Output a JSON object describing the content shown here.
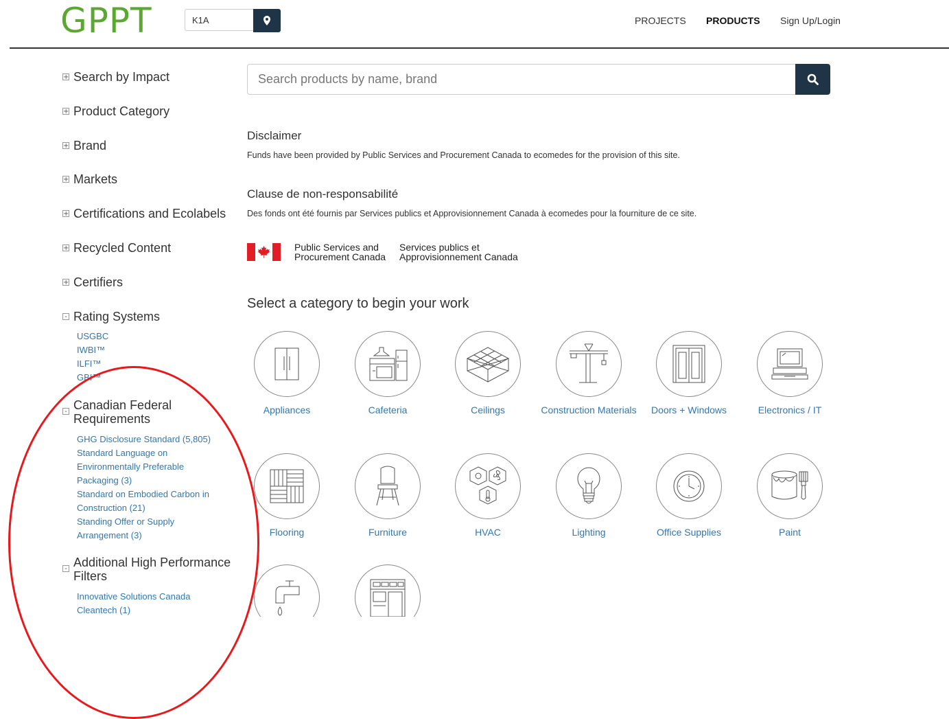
{
  "header": {
    "logo": "GPPT",
    "location_value": "K1A",
    "nav": [
      "PROJECTS",
      "PRODUCTS",
      "Sign Up/Login"
    ]
  },
  "sidebar": {
    "items": [
      {
        "toggle": "+",
        "label": "Search by Impact"
      },
      {
        "toggle": "+",
        "label": "Product Category"
      },
      {
        "toggle": "+",
        "label": "Brand"
      },
      {
        "toggle": "+",
        "label": "Markets"
      },
      {
        "toggle": "+",
        "label": "Certifications and Ecolabels"
      },
      {
        "toggle": "+",
        "label": "Recycled Content"
      },
      {
        "toggle": "+",
        "label": "Certifiers"
      },
      {
        "toggle": "-",
        "label": "Rating Systems"
      },
      {
        "toggle": "-",
        "label": "Canadian Federal Requirements"
      },
      {
        "toggle": "-",
        "label": "Additional High Performance Filters"
      }
    ],
    "rating_systems": [
      "USGBC",
      "IWBI™",
      "ILFI™",
      "GBI™"
    ],
    "federal_requirements": [
      "GHG Disclosure Standard (5,805)",
      "Standard Language on Environmentally Preferable Packaging (3)",
      "Standard on Embodied Carbon in Construction (21)",
      "Standing Offer or Supply Arrangement (3)"
    ],
    "additional_filters": [
      "Innovative Solutions Canada Cleantech (1)"
    ]
  },
  "search": {
    "placeholder": "Search products by name, brand"
  },
  "disclaimer": {
    "title_en": "Disclaimer",
    "text_en": "Funds have been provided by Public Services and Procurement Canada to ecomedes for the provision of this site.",
    "title_fr": "Clause de non-responsabilité",
    "text_fr": "Des fonds ont été fournis par Services publics et Approvisionnement Canada à ecomedes pour la fourniture de ce site.",
    "org_en_1": "Public Services and",
    "org_en_2": "Procurement Canada",
    "org_fr_1": "Services publics et",
    "org_fr_2": "Approvisionnement Canada"
  },
  "categories_title": "Select a category to begin your work",
  "categories": [
    {
      "label": "Appliances",
      "icon": "refrigerator-icon"
    },
    {
      "label": "Cafeteria",
      "icon": "kitchen-icon"
    },
    {
      "label": "Ceilings",
      "icon": "ceiling-grid-icon"
    },
    {
      "label": "Construction Materials",
      "icon": "crane-icon"
    },
    {
      "label": "Doors + Windows",
      "icon": "double-door-icon"
    },
    {
      "label": "Electronics / IT",
      "icon": "computer-icon"
    },
    {
      "label": "Flooring",
      "icon": "parquet-icon"
    },
    {
      "label": "Furniture",
      "icon": "chair-icon"
    },
    {
      "label": "HVAC",
      "icon": "hvac-icon"
    },
    {
      "label": "Lighting",
      "icon": "light-bulb-icon"
    },
    {
      "label": "Office Supplies",
      "icon": "clock-icon"
    },
    {
      "label": "Paint",
      "icon": "paint-can-icon"
    },
    {
      "label": "",
      "icon": "faucet-icon"
    },
    {
      "label": "",
      "icon": "storefront-icon"
    }
  ]
}
